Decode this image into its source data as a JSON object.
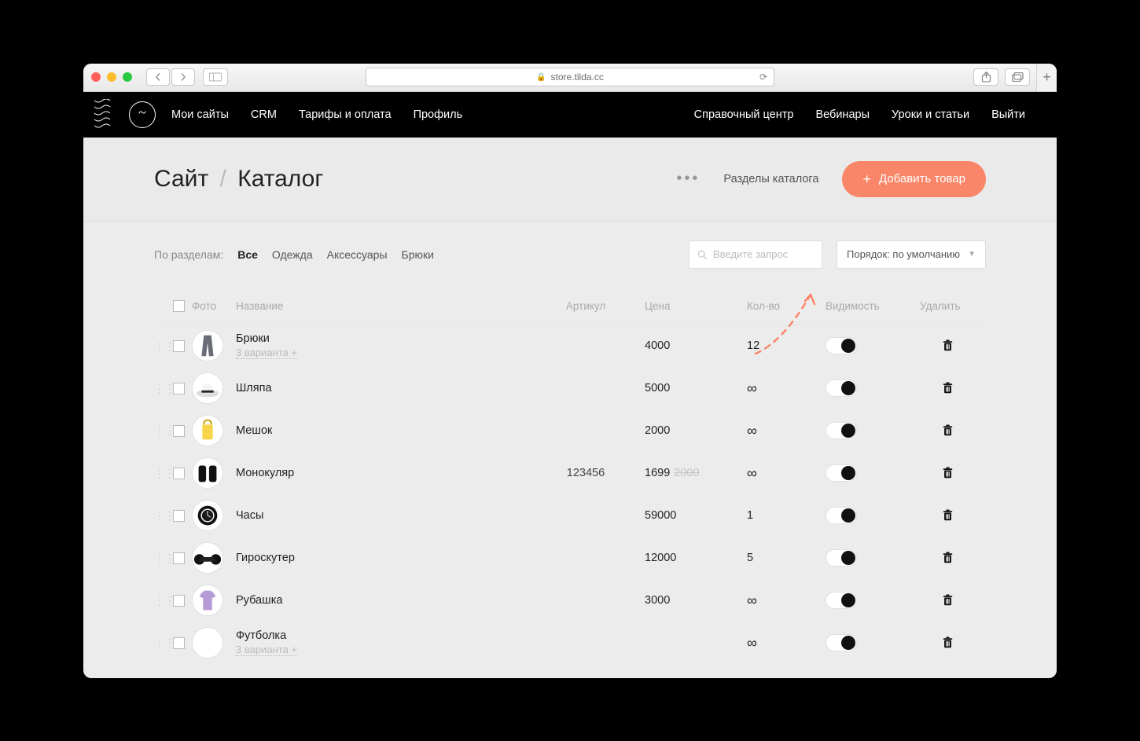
{
  "browser": {
    "address": "store.tilda.cc"
  },
  "nav": {
    "left": [
      "Мои сайты",
      "CRM",
      "Тарифы и оплата",
      "Профиль"
    ],
    "right": [
      "Справочный центр",
      "Вебинары",
      "Уроки и статьи",
      "Выйти"
    ],
    "active_left_index": 0
  },
  "subheader": {
    "bc_root": "Сайт",
    "bc_current": "Каталог",
    "sections_label": "Разделы каталога",
    "add_label": "Добавить товар"
  },
  "filters": {
    "label": "По разделам:",
    "items": [
      "Все",
      "Одежда",
      "Аксессуары",
      "Брюки"
    ],
    "active_index": 0
  },
  "search": {
    "placeholder": "Введите запрос"
  },
  "sort": {
    "label": "Порядок: по умолчанию"
  },
  "columns": {
    "photo": "Фото",
    "name": "Название",
    "sku": "Артикул",
    "price": "Цена",
    "qty": "Кол-во",
    "visibility": "Видимость",
    "delete": "Удалить"
  },
  "rows": [
    {
      "name": "Брюки",
      "variants": "3 варианта +",
      "sku": "",
      "price": "4000",
      "old_price": "",
      "qty": "12",
      "thumb": "pants"
    },
    {
      "name": "Шляпа",
      "variants": "",
      "sku": "",
      "price": "5000",
      "old_price": "",
      "qty": "∞",
      "thumb": "hat"
    },
    {
      "name": "Мешок",
      "variants": "",
      "sku": "",
      "price": "2000",
      "old_price": "",
      "qty": "∞",
      "thumb": "bag"
    },
    {
      "name": "Монокуляр",
      "variants": "",
      "sku": "123456",
      "price": "1699",
      "old_price": "2000",
      "qty": "∞",
      "thumb": "mono"
    },
    {
      "name": "Часы",
      "variants": "",
      "sku": "",
      "price": "59000",
      "old_price": "",
      "qty": "1",
      "thumb": "watch"
    },
    {
      "name": "Гироскутер",
      "variants": "",
      "sku": "",
      "price": "12000",
      "old_price": "",
      "qty": "5",
      "thumb": "hover"
    },
    {
      "name": "Рубашка",
      "variants": "",
      "sku": "",
      "price": "3000",
      "old_price": "",
      "qty": "∞",
      "thumb": "shirt"
    },
    {
      "name": "Футболка",
      "variants": "3 варианта +",
      "sku": "",
      "price": "",
      "old_price": "",
      "qty": "∞",
      "thumb": "blank"
    }
  ]
}
